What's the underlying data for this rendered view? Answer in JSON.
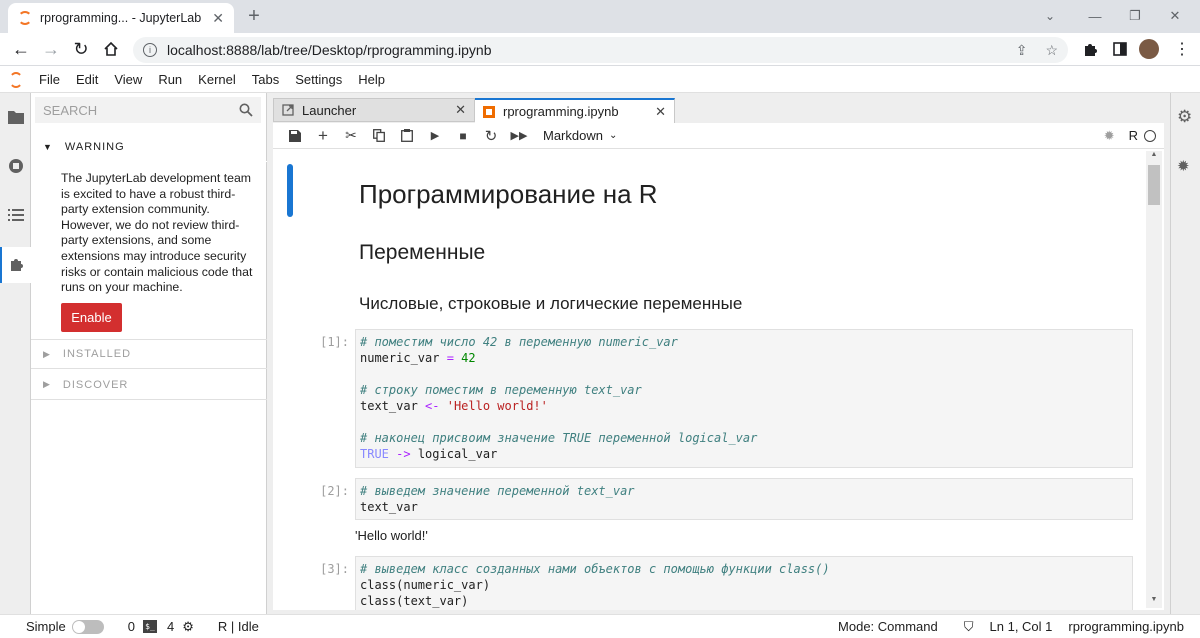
{
  "browser": {
    "tab_title": "rprogramming... - JupyterLab",
    "url": "localhost:8888/lab/tree/Desktop/rprogramming.ipynb"
  },
  "menu": [
    "File",
    "Edit",
    "View",
    "Run",
    "Kernel",
    "Tabs",
    "Settings",
    "Help"
  ],
  "extensions": {
    "search_placeholder": "SEARCH",
    "warning_title": "WARNING",
    "warning_text": "The JupyterLab development team is excited to have a robust third-party extension community. However, we do not review third-party extensions, and some extensions may introduce security risks or contain malicious code that runs on your machine.",
    "enable_label": "Enable",
    "installed_label": "INSTALLED",
    "discover_label": "DISCOVER"
  },
  "tabs": [
    {
      "label": "Launcher"
    },
    {
      "label": "rprogramming.ipynb"
    }
  ],
  "toolbar": {
    "cell_type": "Markdown",
    "kernel": "R"
  },
  "notebook": {
    "h1": "Программирование на R",
    "h2": "Переменные",
    "h3": "Числовые, строковые и логические переменные",
    "cells": [
      {
        "prompt": "[1]:",
        "lines": [
          [
            {
              "t": "# поместим число 42 в переменную numeric_var",
              "c": "cm"
            }
          ],
          [
            {
              "t": "numeric_var ",
              "c": ""
            },
            {
              "t": "=",
              "c": "op"
            },
            {
              "t": " ",
              "c": ""
            },
            {
              "t": "42",
              "c": "num"
            }
          ],
          [
            {
              "t": "",
              "c": ""
            }
          ],
          [
            {
              "t": "# строку поместим в переменную text_var",
              "c": "cm"
            }
          ],
          [
            {
              "t": "text_var ",
              "c": ""
            },
            {
              "t": "<-",
              "c": "op"
            },
            {
              "t": " ",
              "c": ""
            },
            {
              "t": "'Hello world!'",
              "c": "str"
            }
          ],
          [
            {
              "t": "",
              "c": ""
            }
          ],
          [
            {
              "t": "# наконец присвоим значение TRUE переменной logical_var",
              "c": "cm"
            }
          ],
          [
            {
              "t": "TRUE",
              "c": "kw"
            },
            {
              "t": " ",
              "c": ""
            },
            {
              "t": "->",
              "c": "op"
            },
            {
              "t": " logical_var",
              "c": ""
            }
          ]
        ]
      },
      {
        "prompt": "[2]:",
        "lines": [
          [
            {
              "t": "# выведем значение переменной text_var",
              "c": "cm"
            }
          ],
          [
            {
              "t": "text_var",
              "c": ""
            }
          ]
        ],
        "output": "'Hello world!'"
      },
      {
        "prompt": "[3]:",
        "lines": [
          [
            {
              "t": "# выведем класс созданных нами объектов с помощью функции class()",
              "c": "cm"
            }
          ],
          [
            {
              "t": "class(numeric_var)",
              "c": ""
            }
          ],
          [
            {
              "t": "class(text_var)",
              "c": ""
            }
          ]
        ]
      }
    ]
  },
  "status": {
    "mode_label": "Simple",
    "terminals": "0",
    "kernels": "4",
    "kernel_status": "R | Idle",
    "mode": "Mode: Command",
    "position": "Ln 1, Col 1",
    "filename": "rprogramming.ipynb"
  }
}
